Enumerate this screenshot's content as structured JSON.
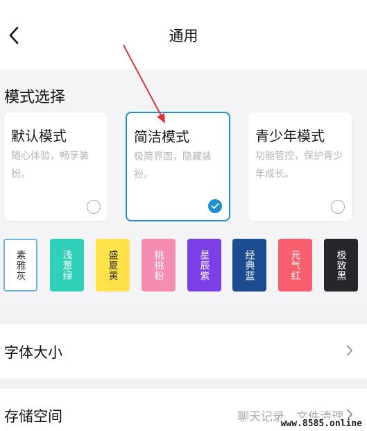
{
  "header": {
    "title": "通用",
    "back_icon": "chevron-left-icon"
  },
  "mode_section": {
    "label": "模式选择",
    "cards": [
      {
        "title": "默认模式",
        "desc": "随心体验，畅享装扮。",
        "selected": false
      },
      {
        "title": "简洁模式",
        "desc": "极简界面，隐藏装扮。",
        "selected": true
      },
      {
        "title": "青少年模式",
        "desc": "功能管控，保护青少年成长。",
        "selected": false
      }
    ],
    "accent_color": "#1e8fd0"
  },
  "themes": [
    {
      "label": "素雅灰",
      "bg": "#ffffff",
      "fg": "#333333",
      "selected": true
    },
    {
      "label": "浅葱绿",
      "bg": "#2fcfb8",
      "fg": "#ffffff",
      "selected": false
    },
    {
      "label": "盛夏黄",
      "bg": "#ffe14a",
      "fg": "#333333",
      "selected": false
    },
    {
      "label": "桃桃粉",
      "bg": "#f58cb1",
      "fg": "#ffffff",
      "selected": false
    },
    {
      "label": "星辰紫",
      "bg": "#7a40e6",
      "fg": "#ffffff",
      "selected": false
    },
    {
      "label": "经典蓝",
      "bg": "#1d4b8f",
      "fg": "#ffffff",
      "selected": false
    },
    {
      "label": "元气红",
      "bg": "#f85f6e",
      "fg": "#ffffff",
      "selected": false
    },
    {
      "label": "极致黑",
      "bg": "#252629",
      "fg": "#ffffff",
      "selected": false
    }
  ],
  "settings": {
    "font_size_label": "字体大小",
    "storage_label": "存储空间",
    "storage_value": "聊天记录、文件清理"
  },
  "watermark": "www.8585.online"
}
